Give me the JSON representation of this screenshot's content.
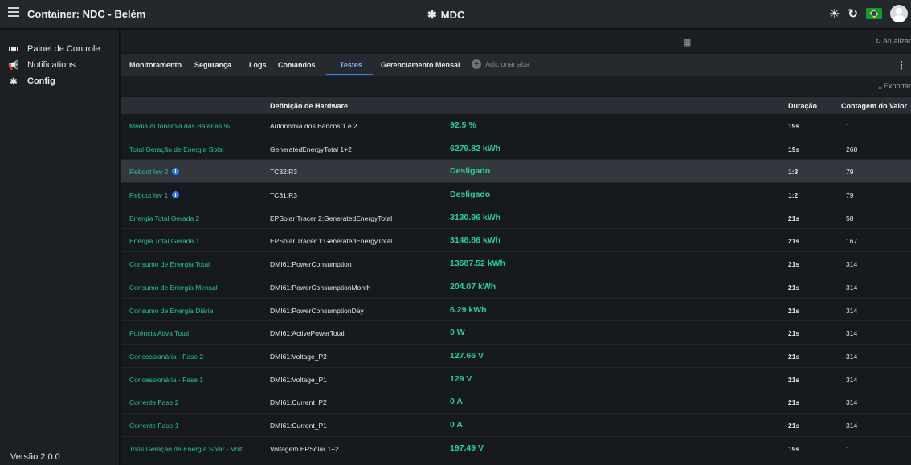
{
  "header": {
    "title": "Container: NDC - Belém",
    "center_title": "MDC"
  },
  "sidebar": {
    "items": [
      {
        "label": "Painel de Controle",
        "icon": "dashboard-icon"
      },
      {
        "label": "Notifications",
        "icon": "megaphone-icon"
      },
      {
        "label": "Config",
        "icon": "gear-icon"
      }
    ],
    "version": "Versão 2.0.0"
  },
  "toolbar": {
    "refresh_label": "Atualizar",
    "export_label": "Exportar"
  },
  "tabs": {
    "items": [
      "Monitoramento",
      "Segurança",
      "Logs",
      "Comandos",
      "Testes",
      "Gerenciamento Mensal"
    ],
    "active": "Testes",
    "add_label": "Adicionar aba"
  },
  "table": {
    "headers": {
      "definition": "Definição de Hardware",
      "duration": "Duração",
      "count": "Contagem do Valor"
    },
    "rows": [
      {
        "name": "Média Autonomia das Baterias %",
        "definition": "Autonomia dos Bancos 1 e 2",
        "value": "92.5 %",
        "duration": "19s",
        "count": "1"
      },
      {
        "name": "Total Geração de Energia Solar",
        "definition": "GeneratedEnergyTotal 1+2",
        "value": "6279.82 kWh",
        "duration": "19s",
        "count": "268"
      },
      {
        "name": "Reboot Inv 2",
        "definition": "TC32:R3",
        "value": "Desligado",
        "duration": "1:3",
        "count": "79",
        "info": true,
        "highlighted": true
      },
      {
        "name": "Reboot Inv 1",
        "definition": "TC31:R3",
        "value": "Desligado",
        "duration": "1:2",
        "count": "79",
        "info": true
      },
      {
        "name": "Energia Total Gerada 2",
        "definition": "EPSolar Tracer 2:GeneratedEnergyTotal",
        "value": "3130.96 kWh",
        "duration": "21s",
        "count": "58"
      },
      {
        "name": "Energia Total Gerada 1",
        "definition": "EPSolar Tracer 1:GeneratedEnergyTotal",
        "value": "3148.86 kWh",
        "duration": "21s",
        "count": "167"
      },
      {
        "name": "Consumo de Energia Total",
        "definition": "DMI61:PowerConsumption",
        "value": "13687.52 kWh",
        "duration": "21s",
        "count": "314"
      },
      {
        "name": "Consumo de Energia Mensal",
        "definition": "DMI61:PowerConsumptionMonth",
        "value": "204.07 kWh",
        "duration": "21s",
        "count": "314"
      },
      {
        "name": "Consumo de Energia Diária",
        "definition": "DMI61:PowerConsumptionDay",
        "value": "6.29 kWh",
        "duration": "21s",
        "count": "314"
      },
      {
        "name": "Potência Ativa Total",
        "definition": "DMI61:ActivePowerTotal",
        "value": "0 W",
        "duration": "21s",
        "count": "314"
      },
      {
        "name": "Concessionária - Fase 2",
        "definition": "DMI61:Voltage_P2",
        "value": "127.66 V",
        "duration": "21s",
        "count": "314"
      },
      {
        "name": "Concessionária - Fase 1",
        "definition": "DMI61:Voltage_P1",
        "value": "129 V",
        "duration": "21s",
        "count": "314"
      },
      {
        "name": "Corrente Fase 2",
        "definition": "DMI61:Current_P2",
        "value": "0 A",
        "duration": "21s",
        "count": "314"
      },
      {
        "name": "Corrente Fase 1",
        "definition": "DMI61:Current_P1",
        "value": "0 A",
        "duration": "21s",
        "count": "314"
      },
      {
        "name": "Total Geração de Energia Solar - Volt",
        "definition": "Voltagem EPSolar 1+2",
        "value": "197.49 V",
        "duration": "19s",
        "count": "1"
      }
    ]
  },
  "colors": {
    "accent": "#2f83ff",
    "value_green": "#2ecf96",
    "name_green": "#27c690"
  }
}
